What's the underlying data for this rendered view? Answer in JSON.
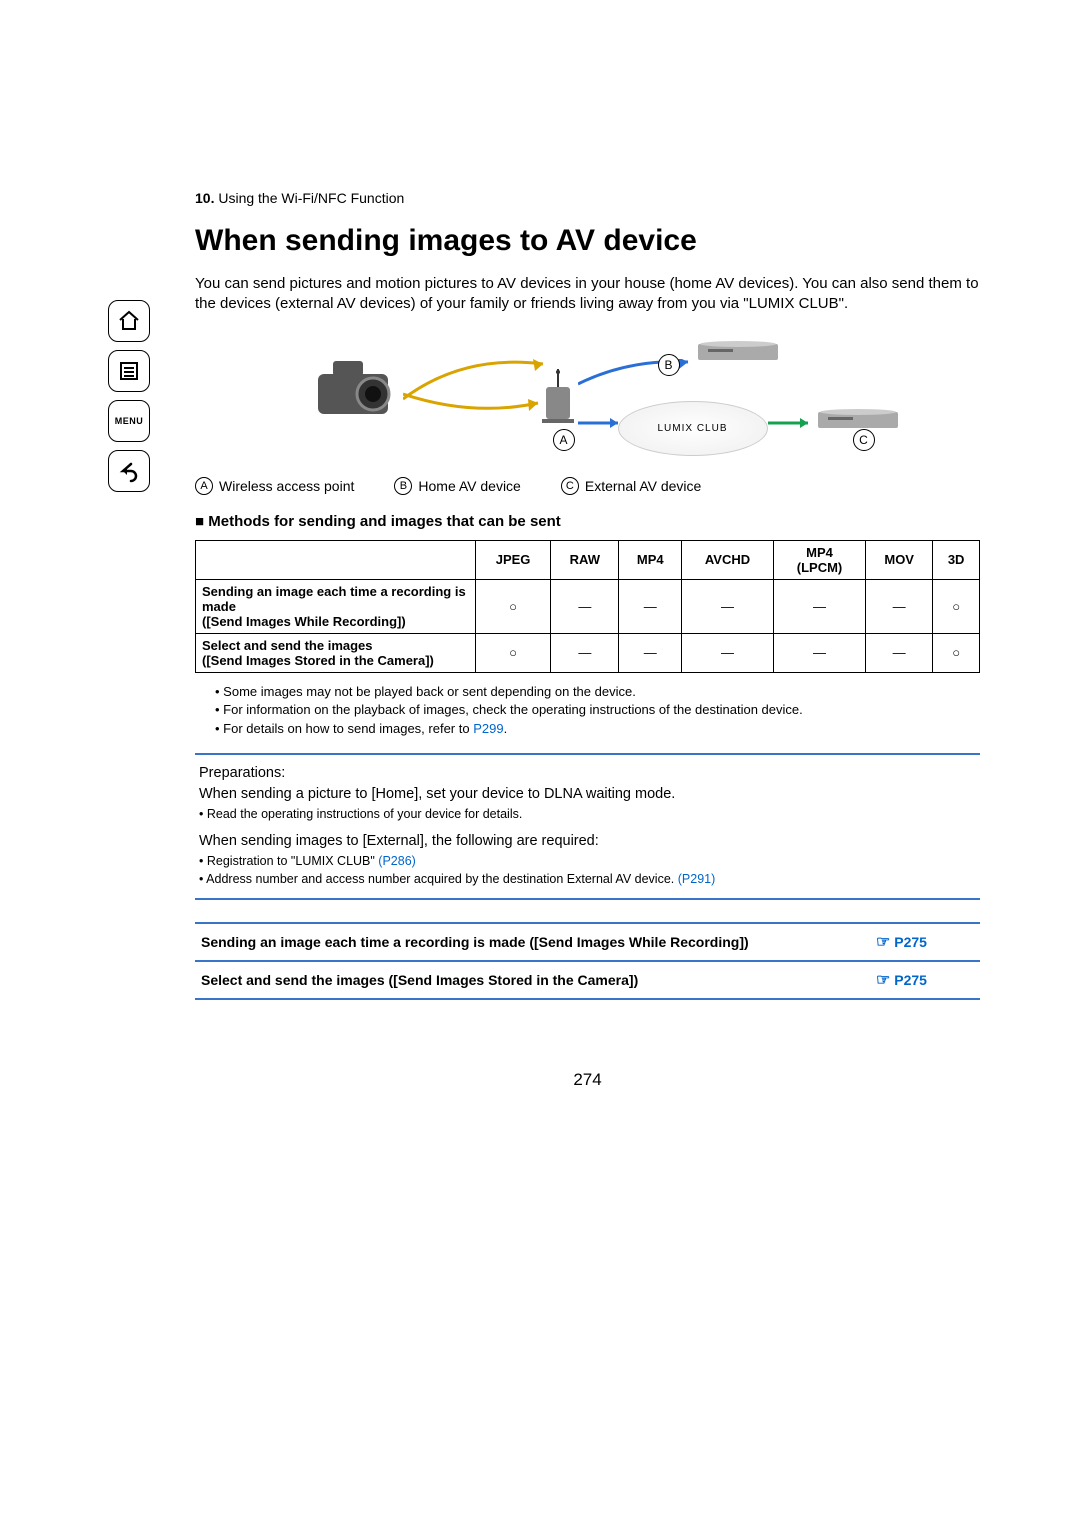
{
  "breadcrumb": {
    "num": "10.",
    "text": "Using the Wi-Fi/NFC Function"
  },
  "title": "When sending images to AV device",
  "intro": "You can send pictures and motion pictures to AV devices in your house (home AV devices). You can also send them to the devices (external AV devices) of your family or friends living away from you via \"LUMIX CLUB\".",
  "diagram": {
    "lumix_label": "LUMIX CLUB",
    "badgeA": "A",
    "badgeB": "B",
    "badgeC": "C"
  },
  "legend": {
    "a": "Wireless access point",
    "b": "Home AV device",
    "c": "External AV device"
  },
  "subhead": "Methods for sending and images that can be sent",
  "table": {
    "headers": [
      "JPEG",
      "RAW",
      "MP4",
      "AVCHD",
      "MP4 (LPCM)",
      "MOV",
      "3D"
    ],
    "rows": [
      {
        "label": "Sending an image each time a recording is made\n([Send Images While Recording])",
        "cells": [
          "○",
          "—",
          "—",
          "—",
          "—",
          "—",
          "○"
        ]
      },
      {
        "label": "Select and send the images\n([Send Images Stored in the Camera])",
        "cells": [
          "○",
          "—",
          "—",
          "—",
          "—",
          "—",
          "○"
        ]
      }
    ]
  },
  "notes": [
    "Some images may not be played back or sent depending on the device.",
    "For information on the playback of images, check the operating instructions of the destination device.",
    "For details on how to send images, refer to "
  ],
  "note3_link": "P299",
  "prep": {
    "heading": "Preparations:",
    "p1": "When sending a picture to [Home], set your device to DLNA waiting mode.",
    "b1": "Read the operating instructions of your device for details.",
    "p2": "When sending images to [External], the following are required:",
    "b2a": "Registration to \"LUMIX CLUB\" ",
    "b2a_link": "(P286)",
    "b2b": "Address number and access number acquired by the destination External AV device. ",
    "b2b_link": "(P291)"
  },
  "refs": [
    {
      "label": "Sending an image each time a recording is made ([Send Images While Recording])",
      "page": "P275"
    },
    {
      "label": "Select and send the images ([Send Images Stored in the Camera])",
      "page": "P275"
    }
  ],
  "pagenum": "274",
  "sidebar": {
    "menu": "MENU"
  }
}
